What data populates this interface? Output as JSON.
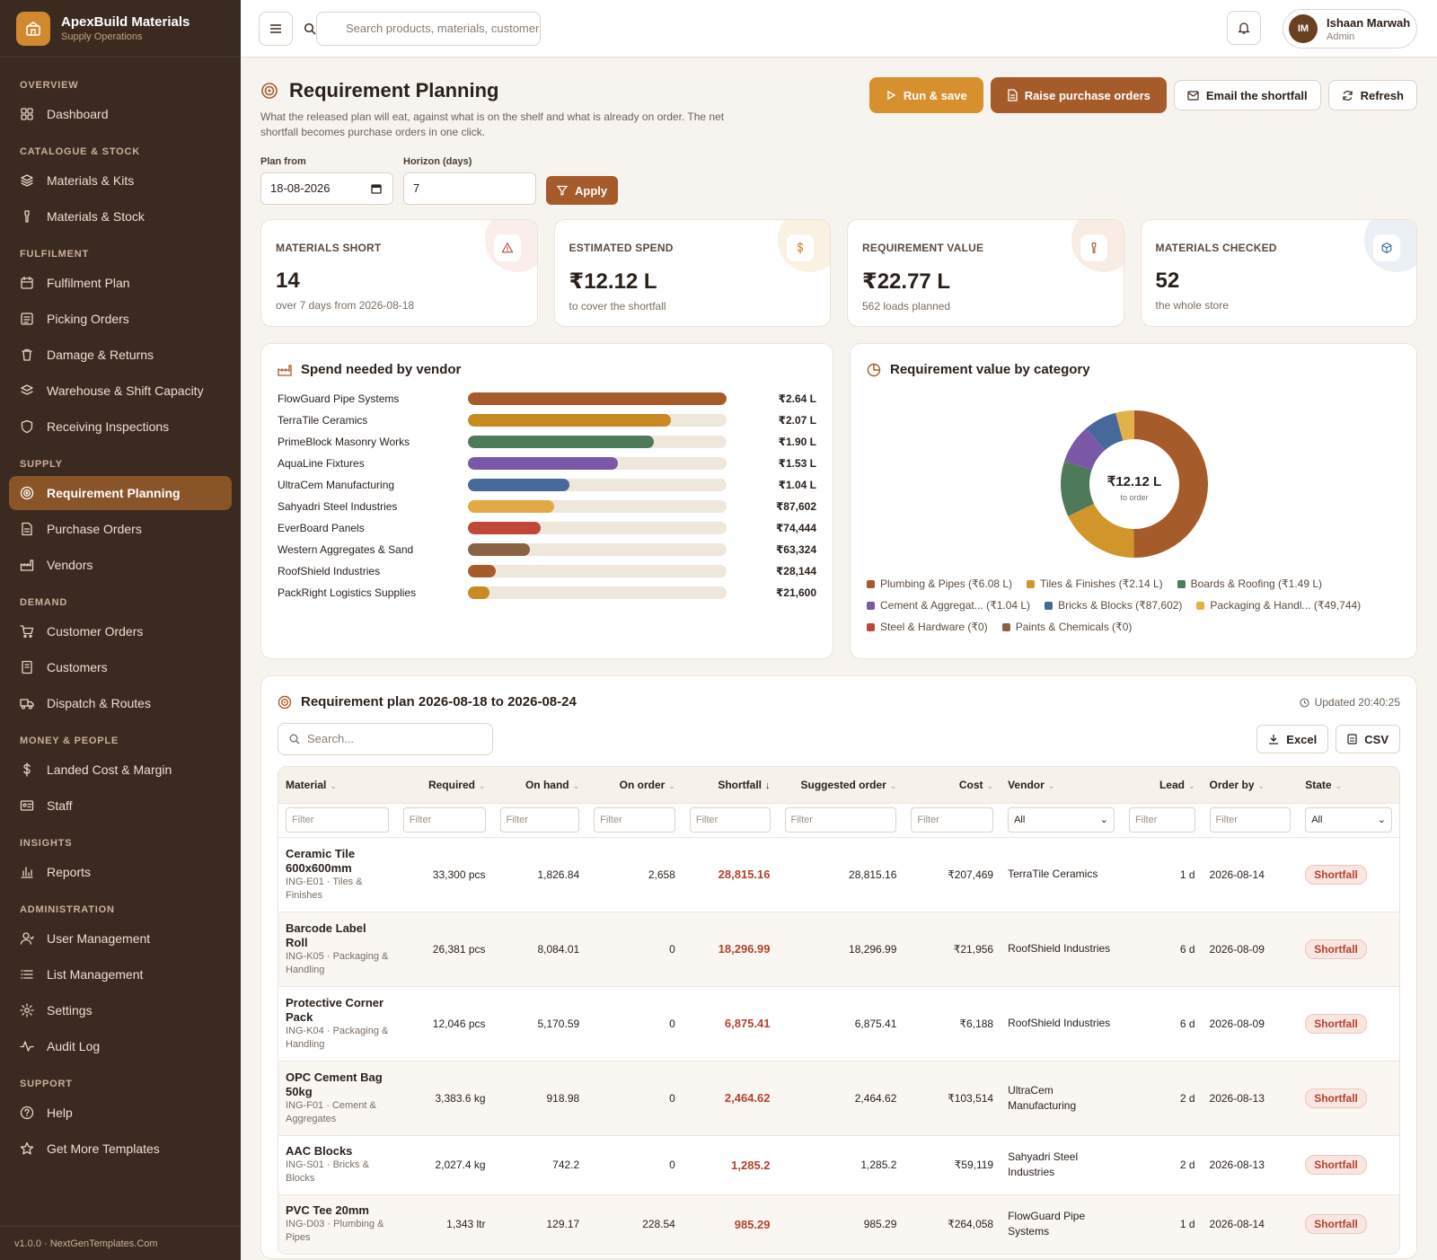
{
  "app": {
    "name": "ApexBuild Materials",
    "subtitle": "Supply Operations",
    "version": "v1.0.0 · NextGenTemplates.Com"
  },
  "sidebar": {
    "sections": [
      {
        "title": "OVERVIEW",
        "items": [
          {
            "label": "Dashboard",
            "icon": "grid-icon"
          }
        ]
      },
      {
        "title": "CATALOGUE & STOCK",
        "items": [
          {
            "label": "Materials & Kits",
            "icon": "layers-icon"
          },
          {
            "label": "Materials & Stock",
            "icon": "tool-icon"
          }
        ]
      },
      {
        "title": "FULFILMENT",
        "items": [
          {
            "label": "Fulfilment Plan",
            "icon": "calendar-icon"
          },
          {
            "label": "Picking Orders",
            "icon": "list-icon"
          },
          {
            "label": "Damage & Returns",
            "icon": "trash-icon"
          },
          {
            "label": "Warehouse & Shift Capacity",
            "icon": "stack-icon"
          },
          {
            "label": "Receiving Inspections",
            "icon": "shield-icon"
          }
        ]
      },
      {
        "title": "SUPPLY",
        "items": [
          {
            "label": "Requirement Planning",
            "icon": "target-icon",
            "active": true
          },
          {
            "label": "Purchase Orders",
            "icon": "file-icon"
          },
          {
            "label": "Vendors",
            "icon": "factory-icon"
          }
        ]
      },
      {
        "title": "DEMAND",
        "items": [
          {
            "label": "Customer Orders",
            "icon": "cart-icon"
          },
          {
            "label": "Customers",
            "icon": "book-icon"
          },
          {
            "label": "Dispatch & Routes",
            "icon": "truck-icon"
          }
        ]
      },
      {
        "title": "MONEY & PEOPLE",
        "items": [
          {
            "label": "Landed Cost & Margin",
            "icon": "dollar-icon"
          },
          {
            "label": "Staff",
            "icon": "id-card-icon"
          }
        ]
      },
      {
        "title": "INSIGHTS",
        "items": [
          {
            "label": "Reports",
            "icon": "bar-chart-icon"
          }
        ]
      },
      {
        "title": "ADMINISTRATION",
        "items": [
          {
            "label": "User Management",
            "icon": "user-icon"
          },
          {
            "label": "List Management",
            "icon": "list-lines-icon"
          },
          {
            "label": "Settings",
            "icon": "gear-icon"
          },
          {
            "label": "Audit Log",
            "icon": "activity-icon"
          }
        ]
      },
      {
        "title": "SUPPORT",
        "items": [
          {
            "label": "Help",
            "icon": "help-icon"
          },
          {
            "label": "Get More Templates",
            "icon": "star-icon"
          }
        ]
      }
    ]
  },
  "topbar": {
    "search_placeholder": "Search products, materials, customers",
    "user": {
      "initials": "IM",
      "name": "Ishaan Marwah",
      "role": "Admin"
    }
  },
  "page": {
    "title": "Requirement Planning",
    "description": "What the released plan will eat, against what is on the shelf and what is already on order. The net shortfall becomes purchase orders in one click.",
    "actions": {
      "run": "Run & save",
      "raise": "Raise purchase orders",
      "email": "Email the shortfall",
      "refresh": "Refresh"
    },
    "filters": {
      "plan_from_label": "Plan from",
      "plan_from": "18-08-2026",
      "horizon_label": "Horizon (days)",
      "horizon": "7",
      "apply": "Apply"
    }
  },
  "kpis": [
    {
      "label": "MATERIALS SHORT",
      "value": "14",
      "sub": "over 7 days from 2026-08-18",
      "icon": "warning-icon",
      "color": "#c0493a",
      "tint": "#fbeeea"
    },
    {
      "label": "ESTIMATED SPEND",
      "value": "₹12.12 L",
      "sub": "to cover the shortfall",
      "icon": "dollar-icon",
      "color": "#c98a22",
      "tint": "#fbf1e0"
    },
    {
      "label": "REQUIREMENT VALUE",
      "value": "₹22.77 L",
      "sub": "562 loads planned",
      "icon": "tool-icon",
      "color": "#a65b2a",
      "tint": "#f8ece3"
    },
    {
      "label": "MATERIALS CHECKED",
      "value": "52",
      "sub": "the whole store",
      "icon": "box-icon",
      "color": "#3f6f9a",
      "tint": "#eaf0f6"
    }
  ],
  "chart_data": [
    {
      "type": "bar",
      "title": "Spend needed by vendor",
      "orientation": "horizontal",
      "categories": [
        "FlowGuard Pipe Systems",
        "TerraTile Ceramics",
        "PrimeBlock Masonry Works",
        "AquaLine Fixtures",
        "UltraCem Manufacturing",
        "Sahyadri Steel Industries",
        "EverBoard Panels",
        "Western Aggregates & Sand",
        "RoofShield Industries",
        "PackRight Logistics Supplies"
      ],
      "values": [
        264000,
        207000,
        190000,
        153000,
        104000,
        87602,
        74444,
        63324,
        28144,
        21600
      ],
      "value_labels": [
        "₹2.64 L",
        "₹2.07 L",
        "₹1.90 L",
        "₹1.53 L",
        "₹1.04 L",
        "₹87,602",
        "₹74,444",
        "₹63,324",
        "₹28,144",
        "₹21,600"
      ],
      "colors": [
        "#a65b2a",
        "#c98a22",
        "#4f7a5a",
        "#7b57a8",
        "#46689a",
        "#e2a944",
        "#c0473a",
        "#8a6244",
        "#a65b2a",
        "#c98a22"
      ]
    },
    {
      "type": "pie",
      "title": "Requirement value by category",
      "donut": true,
      "center_value": "₹12.12 L",
      "center_label": "to order",
      "categories": [
        "Plumbing & Pipes",
        "Tiles & Finishes",
        "Boards & Roofing",
        "Cement & Aggregat...",
        "Bricks & Blocks",
        "Packaging & Handl...",
        "Steel & Hardware",
        "Paints & Chemicals"
      ],
      "values": [
        608000,
        214000,
        149000,
        104000,
        87602,
        49744,
        0,
        0
      ],
      "legend_labels": [
        "Plumbing & Pipes (₹6.08 L)",
        "Tiles & Finishes (₹2.14 L)",
        "Boards & Roofing (₹1.49 L)",
        "Cement & Aggregat... (₹1.04 L)",
        "Bricks & Blocks (₹87,602)",
        "Packaging & Handl... (₹49,744)",
        "Steel & Hardware (₹0)",
        "Paints & Chemicals (₹0)"
      ],
      "colors": [
        "#a65b2a",
        "#d0962a",
        "#4f7a5a",
        "#7b57a8",
        "#46689a",
        "#e2b24a",
        "#c0473a",
        "#8a6244"
      ]
    }
  ],
  "plan": {
    "title": "Requirement plan 2026-08-18 to 2026-08-24",
    "updated": "Updated 20:40:25",
    "search_placeholder": "Search...",
    "excel": "Excel",
    "csv": "CSV",
    "columns": [
      "Material",
      "Required",
      "On hand",
      "On order",
      "Shortfall",
      "Suggested order",
      "Cost",
      "Vendor",
      "Lead",
      "Order by",
      "State"
    ],
    "filter_placeholder": "Filter",
    "select_all": "All",
    "rows": [
      {
        "name": "Ceramic Tile 600x600mm",
        "sub": "ING-E01 · Tiles & Finishes",
        "required": "33,300 pcs",
        "on_hand": "1,826.84",
        "on_order": "2,658",
        "shortfall": "28,815.16",
        "suggested": "28,815.16",
        "cost": "₹207,469",
        "vendor": "TerraTile Ceramics",
        "lead": "1 d",
        "order_by": "2026-08-14",
        "state": "Shortfall"
      },
      {
        "name": "Barcode Label Roll",
        "sub": "ING-K05 · Packaging & Handling",
        "required": "26,381 pcs",
        "on_hand": "8,084.01",
        "on_order": "0",
        "shortfall": "18,296.99",
        "suggested": "18,296.99",
        "cost": "₹21,956",
        "vendor": "RoofShield Industries",
        "lead": "6 d",
        "order_by": "2026-08-09",
        "state": "Shortfall"
      },
      {
        "name": "Protective Corner Pack",
        "sub": "ING-K04 · Packaging & Handling",
        "required": "12,046 pcs",
        "on_hand": "5,170.59",
        "on_order": "0",
        "shortfall": "6,875.41",
        "suggested": "6,875.41",
        "cost": "₹6,188",
        "vendor": "RoofShield Industries",
        "lead": "6 d",
        "order_by": "2026-08-09",
        "state": "Shortfall"
      },
      {
        "name": "OPC Cement Bag 50kg",
        "sub": "ING-F01 · Cement & Aggregates",
        "required": "3,383.6 kg",
        "on_hand": "918.98",
        "on_order": "0",
        "shortfall": "2,464.62",
        "suggested": "2,464.62",
        "cost": "₹103,514",
        "vendor": "UltraCem Manufacturing",
        "lead": "2 d",
        "order_by": "2026-08-13",
        "state": "Shortfall"
      },
      {
        "name": "AAC Blocks",
        "sub": "ING-S01 · Bricks & Blocks",
        "required": "2,027.4 kg",
        "on_hand": "742.2",
        "on_order": "0",
        "shortfall": "1,285.2",
        "suggested": "1,285.2",
        "cost": "₹59,119",
        "vendor": "Sahyadri Steel Industries",
        "lead": "2 d",
        "order_by": "2026-08-13",
        "state": "Shortfall"
      },
      {
        "name": "PVC Tee 20mm",
        "sub": "ING-D03 · Plumbing & Pipes",
        "required": "1,343 ltr",
        "on_hand": "129.17",
        "on_order": "228.54",
        "shortfall": "985.29",
        "suggested": "985.29",
        "cost": "₹264,058",
        "vendor": "FlowGuard Pipe Systems",
        "lead": "1 d",
        "order_by": "2026-08-14",
        "state": "Shortfall"
      }
    ]
  }
}
